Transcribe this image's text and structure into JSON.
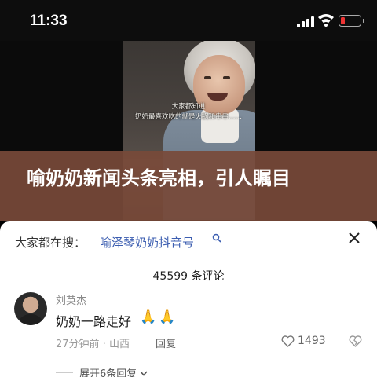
{
  "status_bar": {
    "time": "11:33",
    "icons": [
      "signal-icon",
      "wifi-icon",
      "battery-icon"
    ],
    "battery_level": 0.15,
    "battery_color": "#e33333"
  },
  "video": {
    "caption_line1": "大家都知道",
    "caption_line2": "奶奶最喜欢吃的就是火锅和串串……"
  },
  "headline": "喻奶奶新闻头条亮相，引人瞩目",
  "comments_panel": {
    "search_prefix": "大家都在搜：",
    "search_link": "喻泽琴奶奶抖音号",
    "search_link_color": "#3b5db0",
    "close_icon": "close-icon",
    "count_text": "45599 条评论",
    "comments": [
      {
        "author": "刘英杰",
        "text": "奶奶一路走好",
        "emoji": "🙏",
        "meta": "27分钟前 · 山西",
        "reply_label": "回复",
        "likes": "1493",
        "expand_label": "展开6条回复"
      }
    ]
  },
  "colors": {
    "headline_bg": "#784a3a",
    "link": "#3b5db0"
  }
}
